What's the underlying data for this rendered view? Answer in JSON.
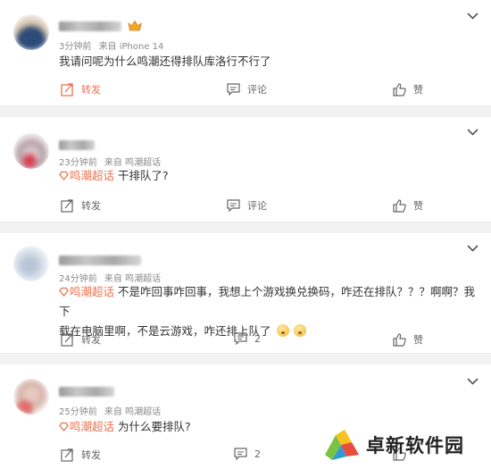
{
  "comments": [
    {
      "time": "3分钟前",
      "source": "来自 iPhone 14",
      "tag": "",
      "text": "我请问呢为什么鸣潮还得排队库洛行不行了",
      "share_label": "转发",
      "comment_label": "评论",
      "like_label": "赞"
    },
    {
      "time": "23分钟前",
      "source": "来自 鸣潮超话",
      "tag": "鸣潮超话",
      "text": "干排队了?",
      "share_label": "转发",
      "comment_label": "评论",
      "like_label": "赞"
    },
    {
      "time": "24分钟前",
      "source": "来自 鸣潮超话",
      "tag": "鸣潮超话",
      "text_line1": "不是咋回事咋回事，我想上个游戏换兑换码，咋还在排队？？？啊啊？我下",
      "text_line2": "载在电脑里啊，不是云游戏，咋还排上队了",
      "share_label": "转发",
      "comment_count": "2",
      "like_label": "赞"
    },
    {
      "time": "25分钟前",
      "source": "来自 鸣潮超话",
      "tag": "鸣潮超话",
      "text": "为什么要排队?",
      "share_label": "转发",
      "comment_count": "2",
      "like_label": "赞"
    }
  ],
  "watermark": {
    "text": "卓新软件园"
  },
  "colors": {
    "accent": "#eb7350",
    "text": "#333333",
    "muted": "#8a8a8a",
    "background": "#f2f2f2"
  },
  "icons": [
    "share-icon",
    "comment-icon",
    "like-icon",
    "chevron-down-icon",
    "supertopic-icon",
    "crown-icon"
  ]
}
